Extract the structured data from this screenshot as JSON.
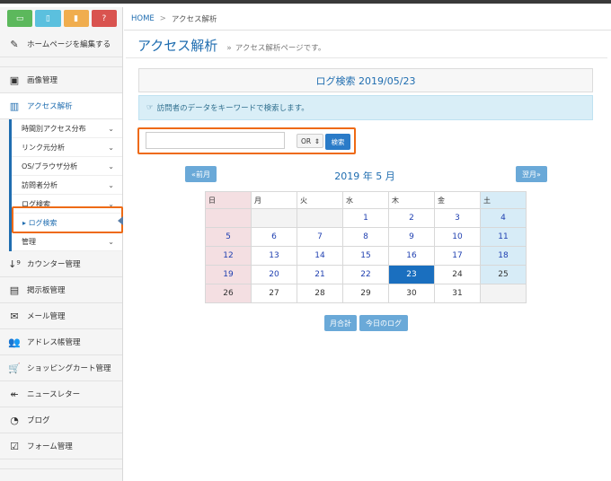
{
  "topbuttons": [
    {
      "icon": "laptop-icon",
      "glyph": "▭",
      "color": "#5cb85c"
    },
    {
      "icon": "tablet-icon",
      "glyph": "▯",
      "color": "#5bc0de"
    },
    {
      "icon": "mobile-icon",
      "glyph": "▮",
      "color": "#f0ad4e"
    },
    {
      "icon": "help-icon",
      "glyph": "?",
      "color": "#d9534f"
    }
  ],
  "sidebar": {
    "edit_home": "ホームページを編集する",
    "image": "画像管理",
    "access": "アクセス解析",
    "sub": [
      "時間別アクセス分布",
      "リンク元分析",
      "OS/ブラウザ分析",
      "訪問者分析",
      "ログ検索",
      "ログ検索",
      "管理"
    ],
    "items": [
      "カウンター管理",
      "掲示板管理",
      "メール管理",
      "アドレス帳管理",
      "ショッピングカート管理",
      "ニュースレター",
      "ブログ",
      "フォーム管理"
    ]
  },
  "breadcrumb": {
    "home": "HOME",
    "separator": ">",
    "current": "アクセス解析"
  },
  "header": {
    "title": "アクセス解析",
    "arrow": "»",
    "desc": "アクセス解析ページです。"
  },
  "panel": {
    "title": "ログ検索 2019/05/23"
  },
  "info": {
    "text": "訪問者のデータをキーワードで検索します。"
  },
  "search": {
    "value": "",
    "select_value": "OR",
    "button": "検索"
  },
  "calendar": {
    "prev": "«前月",
    "next": "翌月»",
    "month_label": "2019 年  5 月",
    "weekdays": [
      "日",
      "月",
      "火",
      "水",
      "木",
      "金",
      "土"
    ],
    "weeks": [
      [
        "",
        "",
        "",
        "1",
        "2",
        "3",
        "4"
      ],
      [
        "5",
        "6",
        "7",
        "8",
        "9",
        "10",
        "11"
      ],
      [
        "12",
        "13",
        "14",
        "15",
        "16",
        "17",
        "18"
      ],
      [
        "19",
        "20",
        "21",
        "22",
        "23",
        "24",
        "25"
      ],
      [
        "26",
        "27",
        "28",
        "29",
        "30",
        "31",
        ""
      ]
    ],
    "today": "23"
  },
  "footer_buttons": {
    "month_total": "月合計",
    "today_log": "今日のログ"
  },
  "colors": {
    "accent": "#1f6db0",
    "highlight": "#ee6a14",
    "today": "#1a6fbf"
  }
}
